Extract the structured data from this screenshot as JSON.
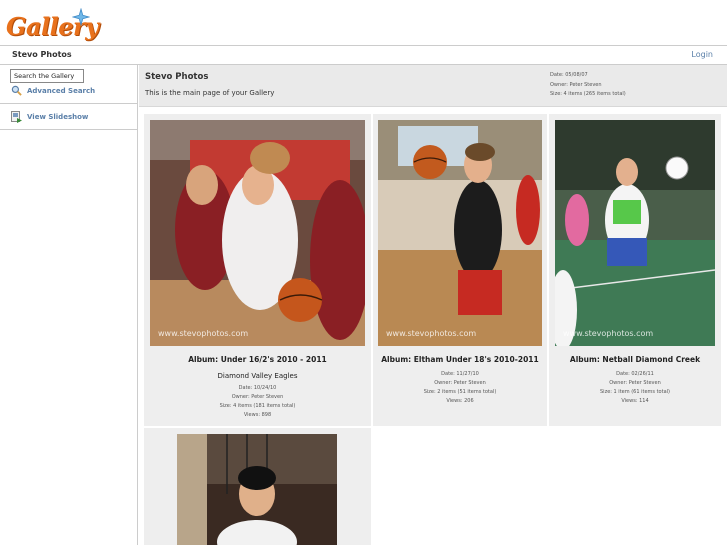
{
  "logo": {
    "text": "Gallery"
  },
  "header": {
    "breadcrumb": "Stevo Photos",
    "login": "Login"
  },
  "sidebar": {
    "search_value": "Search the Gallery",
    "advanced_search": "Advanced Search",
    "view_slideshow": "View Slideshow"
  },
  "album": {
    "title": "Stevo Photos",
    "description": "This is the main page of your Gallery",
    "date": "Date: 05/08/07",
    "owner": "Owner: Peter Steven",
    "size": "Size: 4 items (265 items total)"
  },
  "items": [
    {
      "title": "Album: Under 16/2's 2010 - 2011",
      "subtitle": "Diamond Valley Eagles",
      "date": "Date: 10/24/10",
      "owner": "Owner: Peter Steven",
      "size": "Size: 4 items (181 items total)",
      "views": "Views: 898",
      "watermark": "www.stevophotos.com"
    },
    {
      "title": "Album: Eltham Under 18's 2010-2011",
      "date": "Date: 11/27/10",
      "owner": "Owner: Peter Steven",
      "size": "Size: 2 items (51 items total)",
      "views": "Views: 206",
      "watermark": "www.stevophotos.com"
    },
    {
      "title": "Album: Netball Diamond Creek",
      "date": "Date: 02/26/11",
      "owner": "Owner: Peter Steven",
      "size": "Size: 1 item (61 items total)",
      "views": "Views: 114",
      "watermark": "www.stevophotos.com"
    },
    {}
  ]
}
